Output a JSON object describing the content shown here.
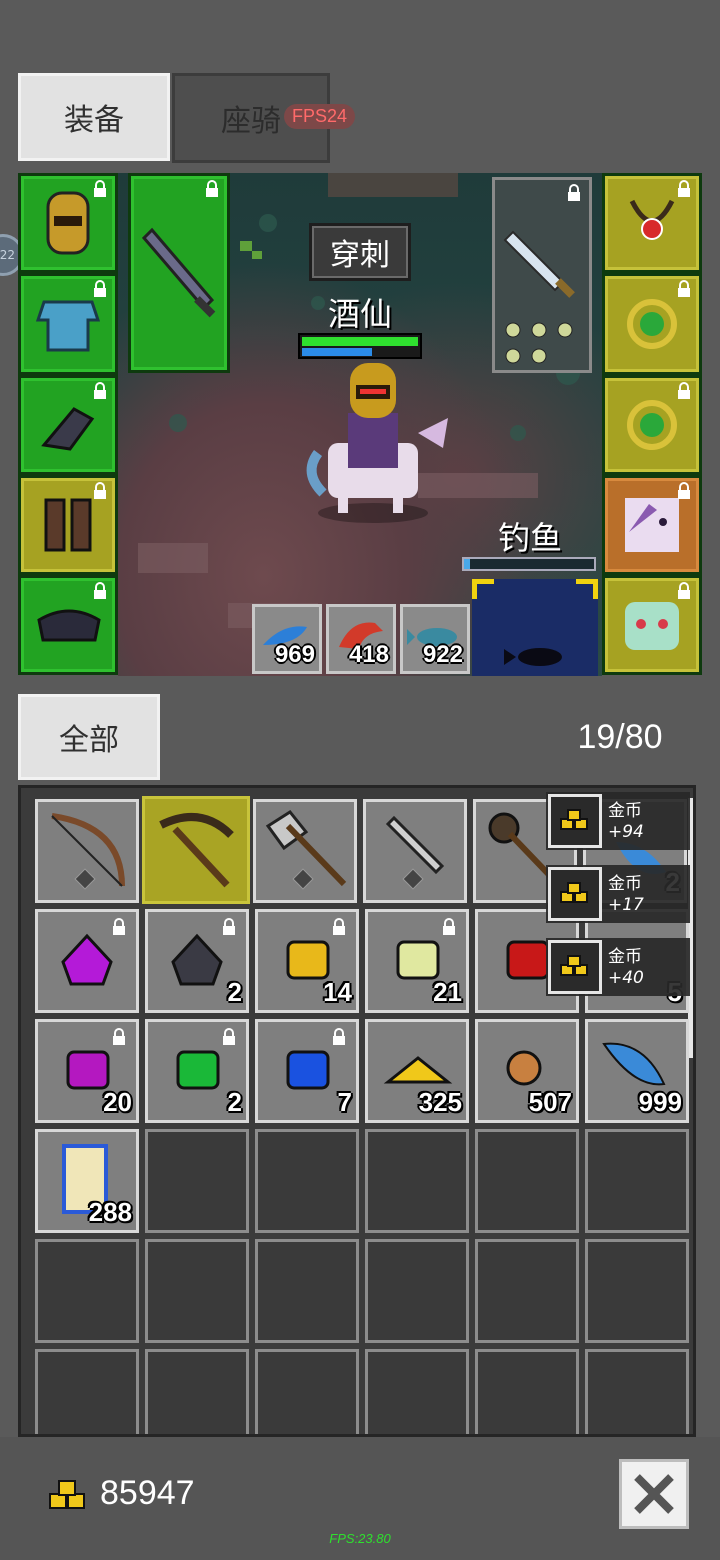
{
  "tabs": {
    "equipment": "装备",
    "mount": "座骑",
    "fps_badge": "FPS24"
  },
  "side_badge": "22",
  "scene": {
    "skill_tooltip": "穿刺",
    "character_name": "酒仙",
    "fishing_label": "钓鱼",
    "resources": [
      {
        "icon": "blue-feather-icon",
        "count": "969"
      },
      {
        "icon": "red-bird-icon",
        "count": "418"
      },
      {
        "icon": "teal-fish-icon",
        "count": "922"
      }
    ]
  },
  "bag": {
    "filter_tab": "全部",
    "capacity": "19/80",
    "counts": {
      "dark_gem": "2",
      "yellow_gem": "14",
      "pale_gem": "21",
      "red_gem": "5",
      "purple_cube": "20",
      "green_cube": "2",
      "blue_cube": "7",
      "gold_pile": "325",
      "meat": "507",
      "feather": "999",
      "scroll": "288",
      "feather_top": "2"
    }
  },
  "toasts": [
    {
      "title": "金币",
      "value": "+94"
    },
    {
      "title": "金币",
      "value": "+17"
    },
    {
      "title": "金币",
      "value": "+40"
    }
  ],
  "footer": {
    "gold": "85947",
    "fps": "FPS:23.80"
  },
  "colors": {
    "slot_green": "#22a322",
    "slot_gold": "#a6a222",
    "background": "#5a5a5a"
  }
}
